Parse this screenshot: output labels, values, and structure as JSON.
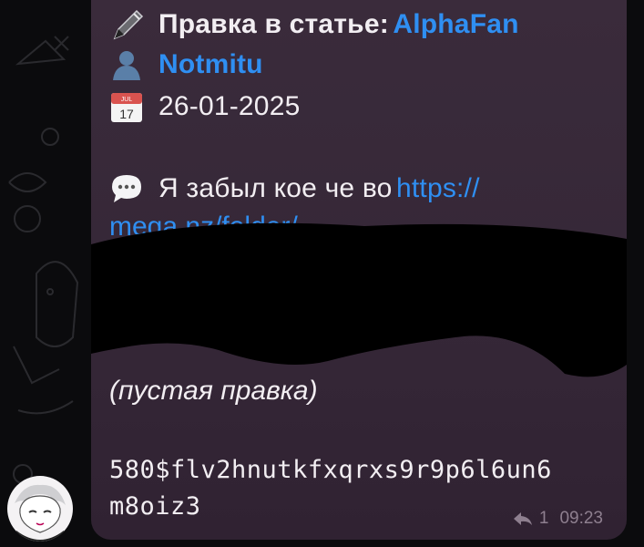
{
  "message": {
    "title_prefix": "Правка в статье:",
    "article": "AlphaFan",
    "author": "Notmitu",
    "date": "26-01-2025",
    "comment_prefix": "Я забыл кое че во",
    "url_part1": "https://",
    "url_part2": "mega.nz/folder/",
    "edit_type": "(пустая правка)",
    "hash_line1": "580$flv2hnutkfxqrxs9r9p6l6un6",
    "hash_line2": "m8oiz3",
    "replies_count": "1",
    "time": "09:23"
  },
  "calendar": {
    "month": "JUL",
    "day": "17"
  },
  "icons": {
    "pen": "pen-icon",
    "user": "user-silhouette-icon",
    "calendar": "calendar-icon",
    "speech": "speech-bubble-icon",
    "reply": "reply-icon"
  },
  "colors": {
    "bubble": "#3a2b3b",
    "link": "#2f8ff2",
    "text": "#f2eef2",
    "meta": "#8e7f8f",
    "background": "#0b0b0d"
  }
}
